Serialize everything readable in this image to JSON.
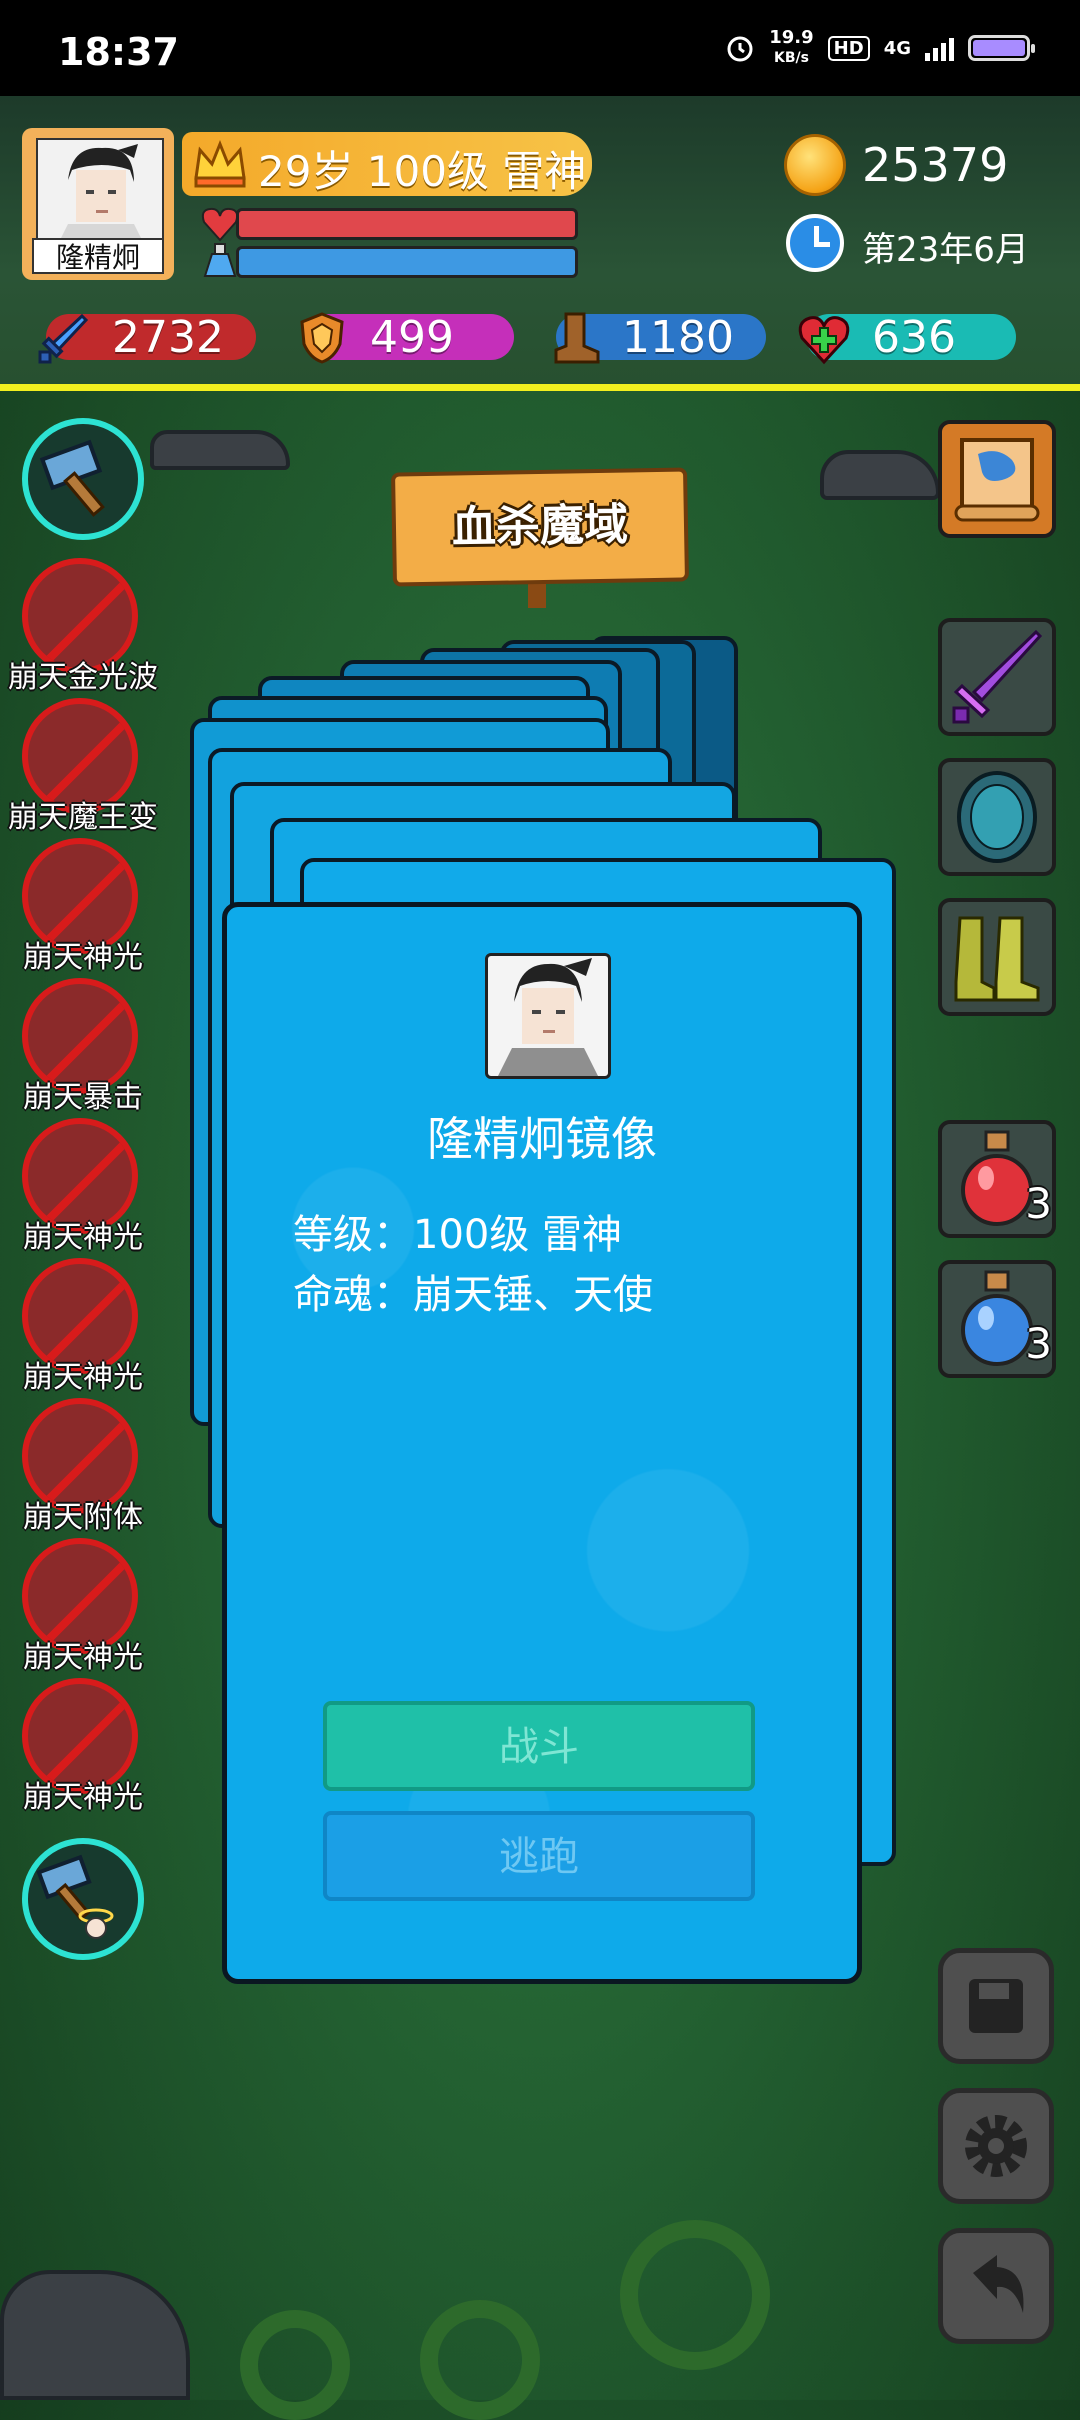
{
  "status_bar": {
    "time": "18:37",
    "net_speed_value": "19.9",
    "net_speed_unit": "KB/s",
    "hd": "HD",
    "network": "4G",
    "icons": [
      "alarm-icon",
      "hd-icon",
      "signal-icon",
      "battery-icon"
    ]
  },
  "player": {
    "avatar_name": "隆精炯",
    "level_text": "29岁 100级 雷神",
    "hp_fraction": 1.0,
    "mp_fraction": 1.0,
    "gold": "25379",
    "date": "第23年6月"
  },
  "stats": [
    {
      "icon": "sword-icon",
      "value": "2732",
      "color": "#d0262b"
    },
    {
      "icon": "shield-icon",
      "value": "499",
      "color": "#d62bc9"
    },
    {
      "icon": "boot-icon",
      "value": "1180",
      "color": "#2b7ad8"
    },
    {
      "icon": "heal-cross-icon",
      "value": "636",
      "color": "#18c7c2"
    }
  ],
  "skills": [
    {
      "label": "崩天金光波"
    },
    {
      "label": "崩天魔王变"
    },
    {
      "label": "崩天神光"
    },
    {
      "label": "崩天暴击"
    },
    {
      "label": "崩天神光"
    },
    {
      "label": "崩天神光"
    },
    {
      "label": "崩天附体"
    },
    {
      "label": "崩天神光"
    },
    {
      "label": "崩天神光"
    }
  ],
  "right_items": [
    {
      "icon": "map-scroll-icon"
    },
    {
      "icon": "purple-sword-icon"
    },
    {
      "icon": "turtle-shell-armor-icon"
    },
    {
      "icon": "boots-icon"
    },
    {
      "icon": "red-potion-icon",
      "count": "3"
    },
    {
      "icon": "blue-potion-icon",
      "count": "3"
    }
  ],
  "right_buttons": [
    "save-icon",
    "settings-gear-icon",
    "back-arrow-icon"
  ],
  "location_sign": "血杀魔域",
  "encounter": {
    "name": "隆精炯镜像",
    "level_line": "等级：100级 雷神",
    "soul_line": "命魂：崩天锤、天使",
    "fight_label": "战斗",
    "flee_label": "逃跑"
  }
}
